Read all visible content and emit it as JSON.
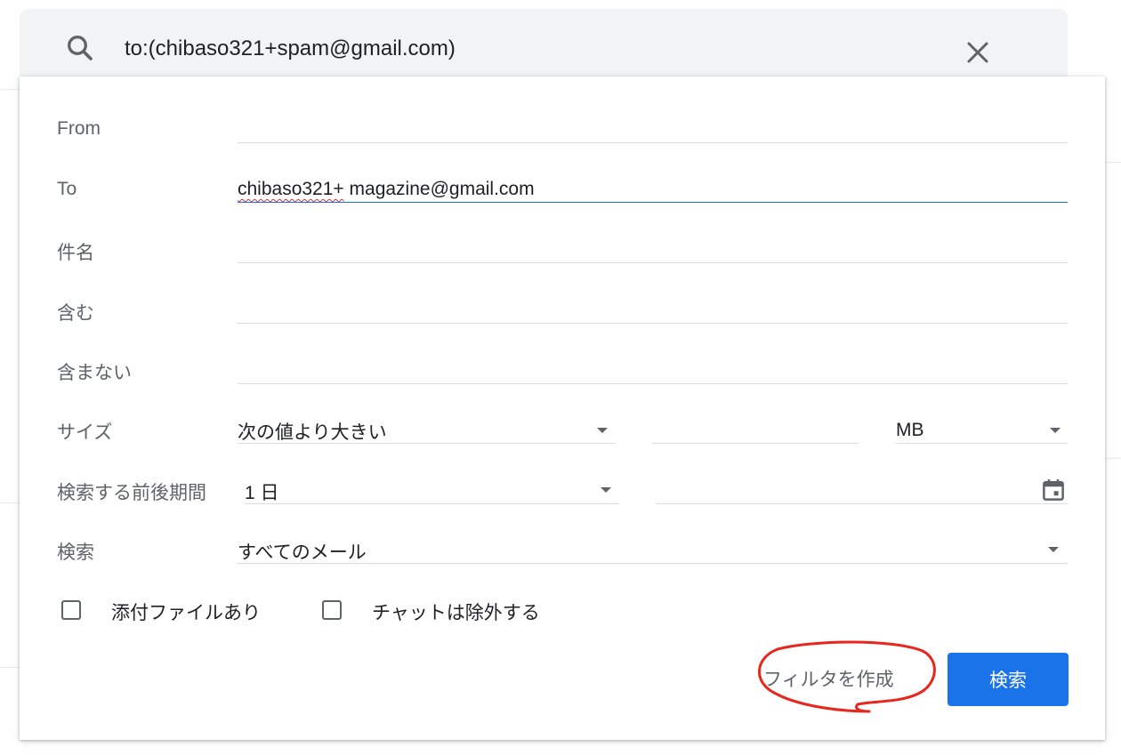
{
  "search": {
    "query": "to:(chibaso321+spam@gmail.com)"
  },
  "form": {
    "from_label": "From",
    "from_value": "",
    "to_label": "To",
    "to_value_prefix": "chibaso321+",
    "to_value_suffix": " magazine@gmail.com",
    "subject_label": "件名",
    "subject_value": "",
    "has_words_label": "含む",
    "has_words_value": "",
    "doesnt_have_label": "含まない",
    "doesnt_have_value": "",
    "size_label": "サイズ",
    "size_operator": "次の値より大きい",
    "size_value": "",
    "size_unit": "MB",
    "date_within_label": "検索する前後期間",
    "date_within_value": "1 日",
    "date_value": "",
    "search_in_label": "検索",
    "search_in_value": "すべてのメール",
    "has_attachment_label": "添付ファイルあり",
    "exclude_chats_label": "チャットは除外する",
    "has_attachment_checked": false,
    "exclude_chats_checked": false
  },
  "actions": {
    "create_filter_label": "フィルタを作成",
    "search_button_label": "検索"
  },
  "colors": {
    "accent": "#1a73e8",
    "annotation": "#e8261c",
    "search_bar_bg": "#f1f3f4"
  }
}
